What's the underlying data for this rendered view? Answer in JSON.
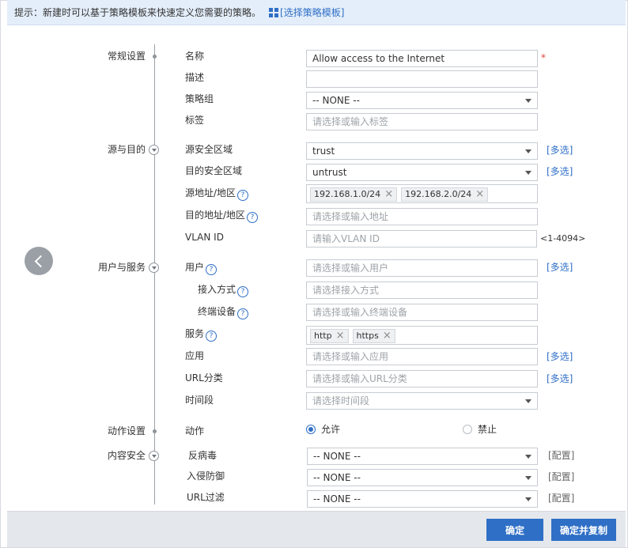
{
  "hint": {
    "text": "提示：新建时可以基于策略模板来快速定义您需要的策略。",
    "icon": "template-icon",
    "link": "[选择策略模板]"
  },
  "sections": {
    "general": "常规设置",
    "src_dst": "源与目的",
    "user_service": "用户与服务",
    "action": "动作设置",
    "content_security": "内容安全"
  },
  "fields": {
    "name": {
      "label": "名称",
      "value": "Allow access to the Internet",
      "required": "*"
    },
    "description": {
      "label": "描述",
      "value": ""
    },
    "policy_group": {
      "label": "策略组",
      "value": "-- NONE --"
    },
    "tag": {
      "label": "标签",
      "placeholder": "请选择或输入标签"
    },
    "src_zone": {
      "label": "源安全区域",
      "value": "trust",
      "link": "[多选]"
    },
    "dst_zone": {
      "label": "目的安全区域",
      "value": "untrust",
      "link": "[多选]"
    },
    "src_addr": {
      "label": "源地址/地区",
      "tags": [
        "192.168.1.0/24",
        "192.168.2.0/24"
      ]
    },
    "dst_addr": {
      "label": "目的地址/地区",
      "placeholder": "请选择或输入地址"
    },
    "vlan": {
      "label": "VLAN ID",
      "placeholder": "请输入VLAN ID",
      "range": "<1-4094>"
    },
    "user": {
      "label": "用户",
      "placeholder": "请选择或输入用户",
      "link": "[多选]"
    },
    "access_mode": {
      "label": "接入方式",
      "placeholder": "请选择接入方式"
    },
    "terminal": {
      "label": "终端设备",
      "placeholder": "请选择或输入终端设备"
    },
    "service": {
      "label": "服务",
      "tags": [
        "http",
        "https"
      ]
    },
    "application": {
      "label": "应用",
      "placeholder": "请选择或输入应用",
      "link": "[多选]"
    },
    "url_category": {
      "label": "URL分类",
      "placeholder": "请选择或输入URL分类",
      "link": "[多选]"
    },
    "time_range": {
      "label": "时间段",
      "placeholder": "请选择时间段"
    },
    "action": {
      "label": "动作",
      "allow": "允许",
      "deny": "禁止",
      "selected": "allow"
    },
    "antivirus": {
      "label": "反病毒",
      "value": "-- NONE --",
      "link": "[配置]"
    },
    "ips": {
      "label": "入侵防御",
      "value": "-- NONE --",
      "link": "[配置]"
    },
    "url_filter": {
      "label": "URL过滤",
      "value": "-- NONE --",
      "link": "[配置]"
    }
  },
  "buttons": {
    "ok": "确定",
    "ok_copy": "确定并复制"
  },
  "colors": {
    "accent": "#2f6fc6",
    "hint_bg": "#e4eefa",
    "required": "#e0443b"
  }
}
